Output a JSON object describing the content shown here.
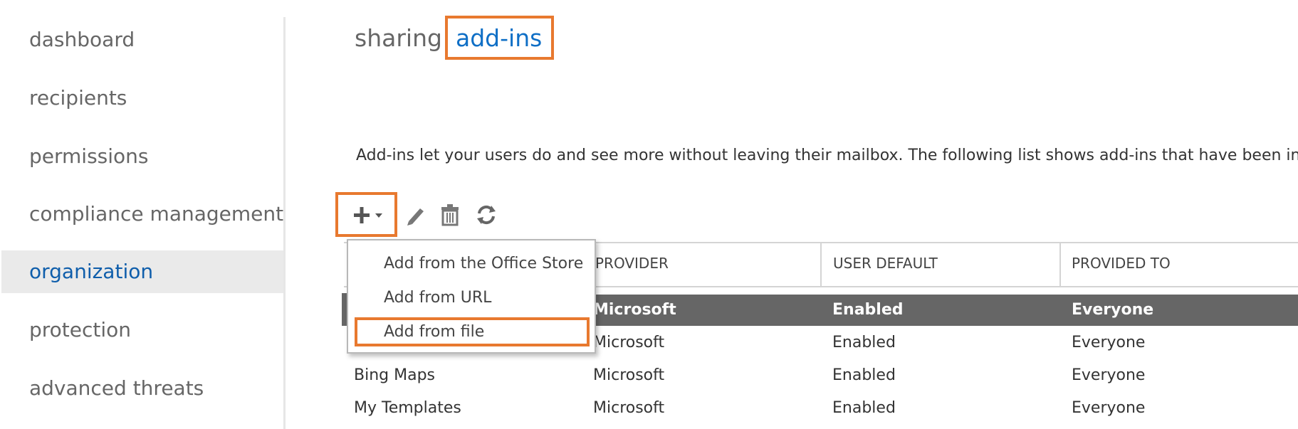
{
  "sidebar": {
    "items": [
      {
        "label": "dashboard",
        "active": false
      },
      {
        "label": "recipients",
        "active": false
      },
      {
        "label": "permissions",
        "active": false
      },
      {
        "label": "compliance management",
        "active": false
      },
      {
        "label": "organization",
        "active": true
      },
      {
        "label": "protection",
        "active": false
      },
      {
        "label": "advanced threats",
        "active": false
      }
    ]
  },
  "tabs": [
    {
      "label": "sharing",
      "active": false
    },
    {
      "label": "add-ins",
      "active": true
    }
  ],
  "description": "Add-ins let your users do and see more without leaving their mailbox. The following list shows add-ins that have been installed",
  "toolbar": {
    "add_icon": "plus-icon",
    "dropdown_icon": "caret-down-icon",
    "edit_icon": "pencil-icon",
    "delete_icon": "trash-icon",
    "refresh_icon": "refresh-icon"
  },
  "add_menu": {
    "items": [
      "Add from the Office Store",
      "Add from URL",
      "Add from file"
    ]
  },
  "grid": {
    "columns": [
      "PROVIDER",
      "USER DEFAULT",
      "PROVIDED TO"
    ],
    "rows": [
      {
        "name": "",
        "provider": "Microsoft",
        "user_default": "Enabled",
        "provided_to": "Everyone",
        "selected": true
      },
      {
        "name": "",
        "provider": "Microsoft",
        "user_default": "Enabled",
        "provided_to": "Everyone",
        "selected": false
      },
      {
        "name": "Bing Maps",
        "provider": "Microsoft",
        "user_default": "Enabled",
        "provided_to": "Everyone",
        "selected": false
      },
      {
        "name": "My Templates",
        "provider": "Microsoft",
        "user_default": "Enabled",
        "provided_to": "Everyone",
        "selected": false
      }
    ]
  },
  "colors": {
    "accent": "#0f6fc6",
    "highlight": "#e8792f",
    "selected_row": "#666666"
  }
}
